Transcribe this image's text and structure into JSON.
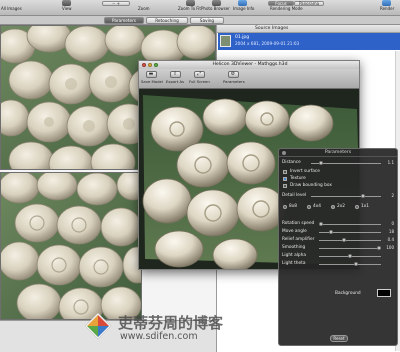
{
  "main_toolbar": {
    "label_images": "All Images",
    "label_view": "View",
    "label_zoom": "Zoom",
    "label_zoom_to_fit": "Zoom To Fit",
    "label_photo_browser": "Photo Browser",
    "label_image_info": "Image Info",
    "label_rendering_mode": "Rendering Mode",
    "label_render": "Render",
    "mode_focus": "Focus",
    "mode_panorama": "Panorama"
  },
  "tabs": [
    {
      "label": "Parameters"
    },
    {
      "label": "Retouching"
    },
    {
      "label": "Saving"
    }
  ],
  "sidebar": {
    "header": "Source Images",
    "selected_file": "01.jpg",
    "selected_meta": "2004 x 681, 2009-09-01 21:03"
  },
  "viewer": {
    "title": "Helicon 3DViewer - Mathggs.h3d",
    "toolbar": [
      {
        "label": "Save Model"
      },
      {
        "label": "Export As"
      },
      {
        "label": "Full Screen"
      },
      {
        "label": "Parameters"
      }
    ]
  },
  "parameters": {
    "title": "Parameters",
    "distance_label": "Distance",
    "distance_value": "1.1",
    "invert_surface_label": "Invert surface",
    "texture_label": "Texture",
    "draw_bbox_label": "Draw bounding box",
    "detail_level_label": "Detail level",
    "detail_level_value": "2",
    "levels": [
      {
        "label": "8x8",
        "selected": false
      },
      {
        "label": "4x4",
        "selected": false
      },
      {
        "label": "2x2",
        "selected": true
      },
      {
        "label": "1x1",
        "selected": false
      }
    ],
    "sliders": [
      {
        "label": "Rotation speed",
        "value": "0",
        "fraction": 0.0
      },
      {
        "label": "Move angle",
        "value": "18",
        "fraction": 0.18
      },
      {
        "label": "Relief amplifier",
        "value": "0.4",
        "fraction": 0.4
      },
      {
        "label": "Smoothing",
        "value": "100",
        "fraction": 1.0
      },
      {
        "label": "Light alpha",
        "value": "",
        "fraction": 0.5
      },
      {
        "label": "Light theta",
        "value": "",
        "fraction": 0.6
      }
    ],
    "background_label": "Background",
    "reset_label": "Reset"
  },
  "watermark": {
    "chinese": "吏蒂芬周的博客",
    "url": "www.sdifen.com"
  },
  "colors": {
    "selection_blue": "#2f62c9",
    "hud_background": "#262626",
    "canvas_background": "#1e261e"
  }
}
